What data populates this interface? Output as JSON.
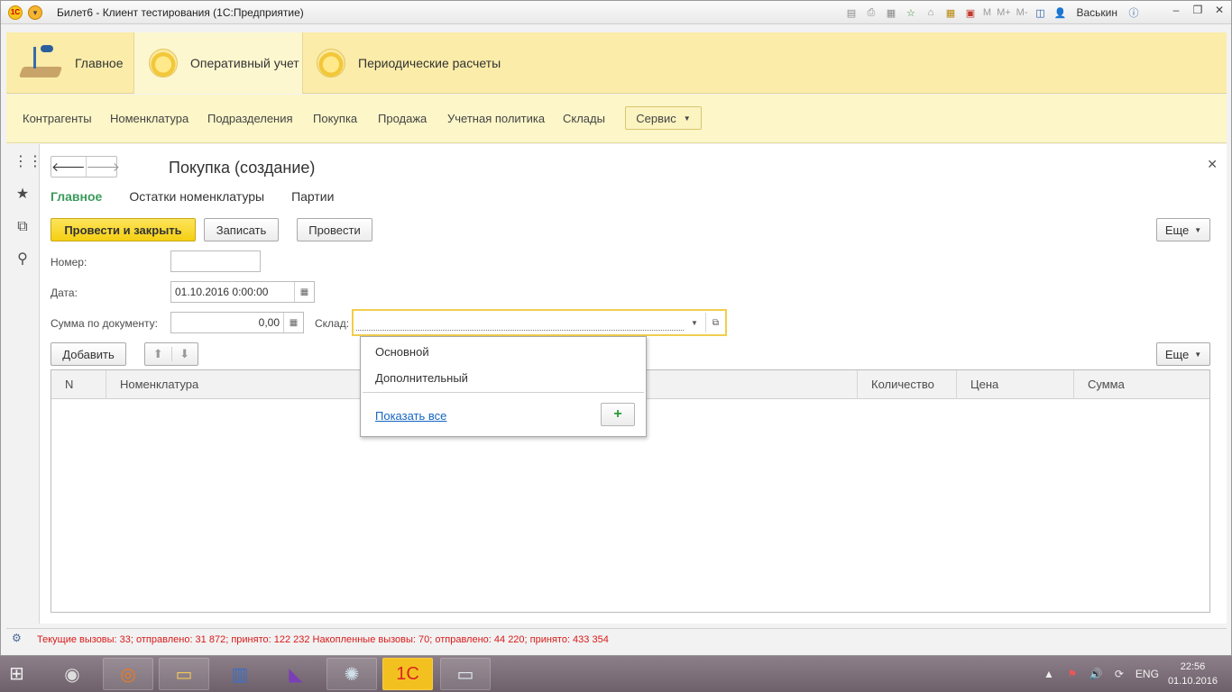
{
  "window": {
    "title": "Билет6  - Клиент тестирования (1С:Предприятие)",
    "app_logo": "1С",
    "user": "Васькин",
    "toolbar_text": [
      "M",
      "M+",
      "M-"
    ]
  },
  "sections": [
    {
      "label": "Главное",
      "icon": "desk-lamp-icon"
    },
    {
      "label": "Оперативный учет",
      "icon": "section-ball-icon"
    },
    {
      "label": "Периодические расчеты",
      "icon": "section-ball-icon"
    }
  ],
  "navbar": {
    "items": [
      "Контрагенты",
      "Номенклатура",
      "Подразделения",
      "Покупка",
      "Продажа",
      "Учетная политика",
      "Склады"
    ],
    "service_label": "Сервис"
  },
  "form": {
    "title": "Покупка (создание)",
    "tabs": [
      "Главное",
      "Остатки номенклатуры",
      "Партии"
    ],
    "buttons": {
      "post_close": "Провести и закрыть",
      "save": "Записать",
      "post": "Провести",
      "more": "Еще",
      "add": "Добавить",
      "more2": "Еще"
    },
    "fields": {
      "number_label": "Номер:",
      "number_value": "",
      "date_label": "Дата:",
      "date_value": "01.10.2016  0:00:00",
      "sum_label": "Сумма по документу:",
      "sum_value": "0,00",
      "warehouse_label": "Склад:",
      "warehouse_value": ""
    },
    "table": {
      "columns": [
        "N",
        "Номенклатура",
        "Количество",
        "Цена",
        "Сумма"
      ]
    }
  },
  "dropdown": {
    "options": [
      "Основной",
      "Дополнительный"
    ],
    "show_all": "Показать все",
    "add_symbol": "+"
  },
  "status": {
    "text": "Текущие вызовы: 33; отправлено: 31 872; принято: 122 232   Накопленные вызовы: 70; отправлено: 44 220; принято: 433 354"
  },
  "taskbar": {
    "apps": [
      "dvd-icon",
      "firefox-icon",
      "file-explorer-icon",
      "server-icon",
      "visual-studio-icon",
      "network-icon",
      "1c-icon",
      "remote-desktop-icon"
    ],
    "language": "ENG",
    "time": "22:56",
    "date": "01.10.2016"
  },
  "colors": {
    "section_bar": "#fbeca9",
    "nav_bar": "#fcf6c8",
    "primary_button": "#f5cf12",
    "active_tab": "#3a9a5b",
    "status_text": "#d81a1a",
    "link": "#1565c0"
  }
}
